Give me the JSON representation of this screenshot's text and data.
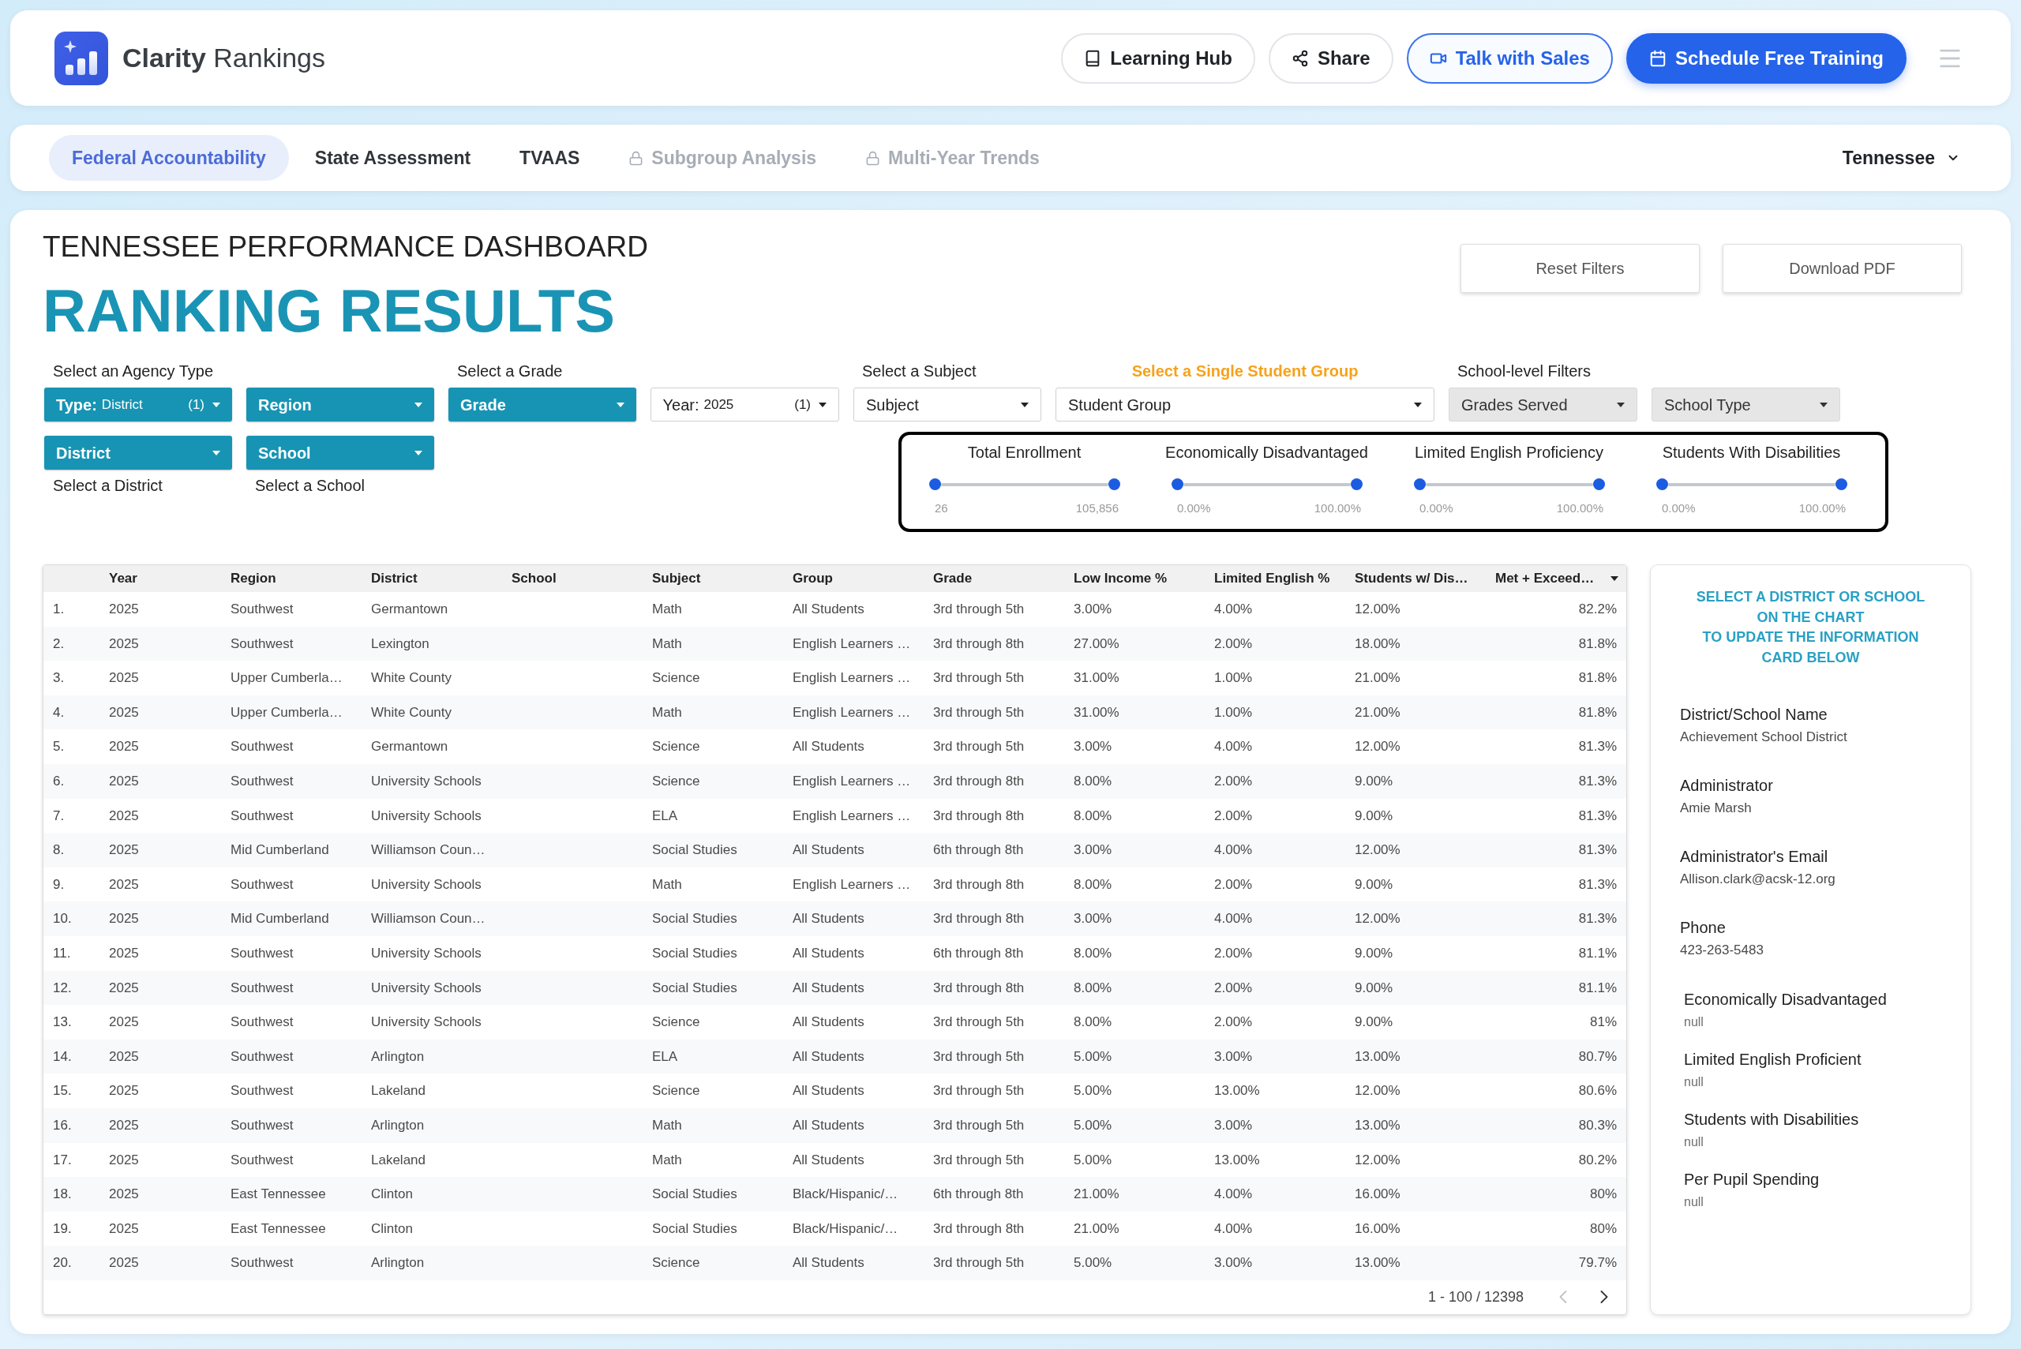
{
  "header": {
    "brand": "**Clarity** Rankings",
    "actions": [
      {
        "label": "Learning Hub",
        "kind": "outline"
      },
      {
        "label": "Share",
        "kind": "outline"
      },
      {
        "label": "Talk with Sales",
        "kind": "accent"
      },
      {
        "label": "Schedule Free Training",
        "kind": "primary"
      }
    ]
  },
  "tabs": [
    {
      "label": "Federal Accountability",
      "selected": true,
      "locked": false
    },
    {
      "label": "State Assessment",
      "selected": false,
      "locked": false
    },
    {
      "label": "TVAAS",
      "selected": false,
      "locked": false
    },
    {
      "label": "Subgroup Analysis",
      "selected": false,
      "locked": true
    },
    {
      "label": "Multi-Year Trends",
      "selected": false,
      "locked": true
    }
  ],
  "state_selector": {
    "value": "Tennessee"
  },
  "dashboard": {
    "subtitle": "TENNESSEE PERFORMANCE DASHBOARD",
    "title": "RANKING RESULTS",
    "buttons": [
      "Reset Filters",
      "Download PDF"
    ]
  },
  "filter_groups": [
    {
      "label": "Select an Agency Type",
      "emphasized": false,
      "dropdowns": [
        {
          "kind": "filled",
          "label": "Type:",
          "value": "District",
          "count": "(1)"
        },
        {
          "kind": "filled",
          "label": "Region"
        }
      ]
    },
    {
      "label": "Select a Grade",
      "emphasized": false,
      "dropdowns": [
        {
          "kind": "filled",
          "label": "Grade"
        },
        {
          "kind": "outlined",
          "label": "Year:",
          "value": "2025",
          "count": "(1)"
        }
      ]
    },
    {
      "label": "Select a Subject",
      "emphasized": false,
      "dropdowns": [
        {
          "kind": "outlined",
          "label": "Subject"
        }
      ]
    },
    {
      "label": "Select a Single Student Group",
      "emphasized": true,
      "dropdowns": [
        {
          "kind": "outlined",
          "label": "Student Group"
        }
      ]
    },
    {
      "label": "School-level Filters",
      "emphasized": false,
      "dropdowns": [
        {
          "kind": "muted",
          "label": "Grades Served"
        },
        {
          "kind": "muted",
          "label": "School Type"
        }
      ]
    }
  ],
  "location_filters": [
    {
      "kind": "filled",
      "label": "District",
      "caption": "Select a District"
    },
    {
      "kind": "filled",
      "label": "School",
      "caption": "Select a School"
    }
  ],
  "range_filters": [
    {
      "title": "Total Enrollment",
      "min_label": "26",
      "max_label": "105,856",
      "level": 1
    },
    {
      "title": "Economically Disadvantaged",
      "min_label": "0.00%",
      "max_label": "100.00%",
      "level": 1
    },
    {
      "title": "Limited English Proficiency",
      "min_label": "0.00%",
      "max_label": "100.00%",
      "level": 1
    },
    {
      "title": "Students With Disabilities",
      "min_label": "0.00%",
      "max_label": "100.00%",
      "level": 1
    }
  ],
  "table": {
    "columns": [
      {
        "label": "Year",
        "sorted": false
      },
      {
        "label": "Region",
        "sorted": false
      },
      {
        "label": "District",
        "sorted": false
      },
      {
        "label": "School",
        "sorted": false
      },
      {
        "label": "Subject",
        "sorted": false
      },
      {
        "label": "Group",
        "sorted": false
      },
      {
        "label": "Grade",
        "sorted": false
      },
      {
        "label": "Low Income %",
        "sorted": false
      },
      {
        "label": "Limited English %",
        "sorted": false
      },
      {
        "label": "Students w/ Dis…",
        "sorted": false
      },
      {
        "label": "Met + Exceed…",
        "sorted": true
      }
    ],
    "rows": [
      {
        "rank": "1.",
        "year": "2025",
        "region": "Southwest",
        "district": "Germantown",
        "subject": "Math",
        "group": "All Students",
        "grade": "3rd through 5th",
        "low_income": "3.00%",
        "limited_english": "4.00%",
        "students_w_dis": "12.00%",
        "met_exceed": "82.2%"
      },
      {
        "rank": "2.",
        "year": "2025",
        "region": "Southwest",
        "district": "Lexington",
        "subject": "Math",
        "group": "English Learners …",
        "grade": "3rd through 8th",
        "low_income": "27.00%",
        "limited_english": "2.00%",
        "students_w_dis": "18.00%",
        "met_exceed": "81.8%"
      },
      {
        "rank": "3.",
        "year": "2025",
        "region": "Upper Cumberla…",
        "district": "White County",
        "subject": "Science",
        "group": "English Learners …",
        "grade": "3rd through 5th",
        "low_income": "31.00%",
        "limited_english": "1.00%",
        "students_w_dis": "21.00%",
        "met_exceed": "81.8%"
      },
      {
        "rank": "4.",
        "year": "2025",
        "region": "Upper Cumberla…",
        "district": "White County",
        "subject": "Math",
        "group": "English Learners …",
        "grade": "3rd through 5th",
        "low_income": "31.00%",
        "limited_english": "1.00%",
        "students_w_dis": "21.00%",
        "met_exceed": "81.8%"
      },
      {
        "rank": "5.",
        "year": "2025",
        "region": "Southwest",
        "district": "Germantown",
        "subject": "Science",
        "group": "All Students",
        "grade": "3rd through 5th",
        "low_income": "3.00%",
        "limited_english": "4.00%",
        "students_w_dis": "12.00%",
        "met_exceed": "81.3%"
      },
      {
        "rank": "6.",
        "year": "2025",
        "region": "Southwest",
        "district": "University Schools",
        "subject": "Science",
        "group": "English Learners …",
        "grade": "3rd through 8th",
        "low_income": "8.00%",
        "limited_english": "2.00%",
        "students_w_dis": "9.00%",
        "met_exceed": "81.3%"
      },
      {
        "rank": "7.",
        "year": "2025",
        "region": "Southwest",
        "district": "University Schools",
        "subject": "ELA",
        "group": "English Learners …",
        "grade": "3rd through 8th",
        "low_income": "8.00%",
        "limited_english": "2.00%",
        "students_w_dis": "9.00%",
        "met_exceed": "81.3%"
      },
      {
        "rank": "8.",
        "year": "2025",
        "region": "Mid Cumberland",
        "district": "Williamson Coun…",
        "subject": "Social Studies",
        "group": "All Students",
        "grade": "6th through 8th",
        "low_income": "3.00%",
        "limited_english": "4.00%",
        "students_w_dis": "12.00%",
        "met_exceed": "81.3%"
      },
      {
        "rank": "9.",
        "year": "2025",
        "region": "Southwest",
        "district": "University Schools",
        "subject": "Math",
        "group": "English Learners …",
        "grade": "3rd through 8th",
        "low_income": "8.00%",
        "limited_english": "2.00%",
        "students_w_dis": "9.00%",
        "met_exceed": "81.3%"
      },
      {
        "rank": "10.",
        "year": "2025",
        "region": "Mid Cumberland",
        "district": "Williamson Coun…",
        "subject": "Social Studies",
        "group": "All Students",
        "grade": "3rd through 8th",
        "low_income": "3.00%",
        "limited_english": "4.00%",
        "students_w_dis": "12.00%",
        "met_exceed": "81.3%"
      },
      {
        "rank": "11.",
        "year": "2025",
        "region": "Southwest",
        "district": "University Schools",
        "subject": "Social Studies",
        "group": "All Students",
        "grade": "6th through 8th",
        "low_income": "8.00%",
        "limited_english": "2.00%",
        "students_w_dis": "9.00%",
        "met_exceed": "81.1%"
      },
      {
        "rank": "12.",
        "year": "2025",
        "region": "Southwest",
        "district": "University Schools",
        "subject": "Social Studies",
        "group": "All Students",
        "grade": "3rd through 8th",
        "low_income": "8.00%",
        "limited_english": "2.00%",
        "students_w_dis": "9.00%",
        "met_exceed": "81.1%"
      },
      {
        "rank": "13.",
        "year": "2025",
        "region": "Southwest",
        "district": "University Schools",
        "subject": "Science",
        "group": "All Students",
        "grade": "3rd through 5th",
        "low_income": "8.00%",
        "limited_english": "2.00%",
        "students_w_dis": "9.00%",
        "met_exceed": "81%"
      },
      {
        "rank": "14.",
        "year": "2025",
        "region": "Southwest",
        "district": "Arlington",
        "subject": "ELA",
        "group": "All Students",
        "grade": "3rd through 5th",
        "low_income": "5.00%",
        "limited_english": "3.00%",
        "students_w_dis": "13.00%",
        "met_exceed": "80.7%"
      },
      {
        "rank": "15.",
        "year": "2025",
        "region": "Southwest",
        "district": "Lakeland",
        "subject": "Science",
        "group": "All Students",
        "grade": "3rd through 5th",
        "low_income": "5.00%",
        "limited_english": "13.00%",
        "students_w_dis": "12.00%",
        "met_exceed": "80.6%"
      },
      {
        "rank": "16.",
        "year": "2025",
        "region": "Southwest",
        "district": "Arlington",
        "subject": "Math",
        "group": "All Students",
        "grade": "3rd through 5th",
        "low_income": "5.00%",
        "limited_english": "3.00%",
        "students_w_dis": "13.00%",
        "met_exceed": "80.3%"
      },
      {
        "rank": "17.",
        "year": "2025",
        "region": "Southwest",
        "district": "Lakeland",
        "subject": "Math",
        "group": "All Students",
        "grade": "3rd through 5th",
        "low_income": "5.00%",
        "limited_english": "13.00%",
        "students_w_dis": "12.00%",
        "met_exceed": "80.2%"
      },
      {
        "rank": "18.",
        "year": "2025",
        "region": "East Tennessee",
        "district": "Clinton",
        "subject": "Social Studies",
        "group": "Black/Hispanic/…",
        "grade": "6th through 8th",
        "low_income": "21.00%",
        "limited_english": "4.00%",
        "students_w_dis": "16.00%",
        "met_exceed": "80%"
      },
      {
        "rank": "19.",
        "year": "2025",
        "region": "East Tennessee",
        "district": "Clinton",
        "subject": "Social Studies",
        "group": "Black/Hispanic/…",
        "grade": "3rd through 8th",
        "low_income": "21.00%",
        "limited_english": "4.00%",
        "students_w_dis": "16.00%",
        "met_exceed": "80%"
      },
      {
        "rank": "20.",
        "year": "2025",
        "region": "Southwest",
        "district": "Arlington",
        "subject": "Science",
        "group": "All Students",
        "grade": "3rd through 5th",
        "low_income": "5.00%",
        "limited_english": "3.00%",
        "students_w_dis": "13.00%",
        "met_exceed": "79.7%"
      }
    ],
    "pagination": {
      "range": "1 - 100 / 12398",
      "prev_disabled": true,
      "next_disabled": false
    }
  },
  "info_card": {
    "instructions": [
      "SELECT A DISTRICT OR SCHOOL",
      "ON THE CHART",
      "TO UPDATE THE INFORMATION",
      "CARD BELOW"
    ],
    "contact_fields": [
      {
        "label": "District/School Name",
        "value": "Achievement School District"
      },
      {
        "label": "Administrator",
        "value": "Amie Marsh"
      },
      {
        "label": "Administrator's Email",
        "value": "Allison.clark@acsk-12.org"
      },
      {
        "label": "Phone",
        "value": "423-263-5483"
      }
    ],
    "stat_fields": [
      {
        "label": "Economically Disadvantaged",
        "value": "null"
      },
      {
        "label": "Limited English Proficient",
        "value": "null"
      },
      {
        "label": "Students with Disabilities",
        "value": "null"
      },
      {
        "label": "Per Pupil Spending",
        "value": "null"
      }
    ]
  }
}
